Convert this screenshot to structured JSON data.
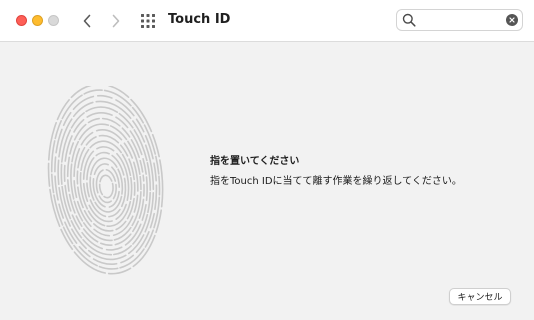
{
  "window": {
    "title": "Touch ID",
    "controls": [
      "close",
      "minimize",
      "zoom"
    ],
    "control_colors": {
      "close": "#fe5f57",
      "minimize": "#febc2e",
      "zoom": "#d9d9d9"
    }
  },
  "toolbar": {
    "back_icon": "chevron-left-icon",
    "forward_icon": "chevron-right-icon",
    "show_all_icon": "grid-icon"
  },
  "search": {
    "value": "",
    "placeholder": "",
    "icon": "search-icon",
    "clear_icon": "clear-icon"
  },
  "main": {
    "fingerprint_icon": "fingerprint-icon",
    "heading": "指を置いてください",
    "instruction": "指をTouch IDに当てて離す作業を繰り返してください。"
  },
  "footer": {
    "cancel_label": "キャンセル"
  }
}
